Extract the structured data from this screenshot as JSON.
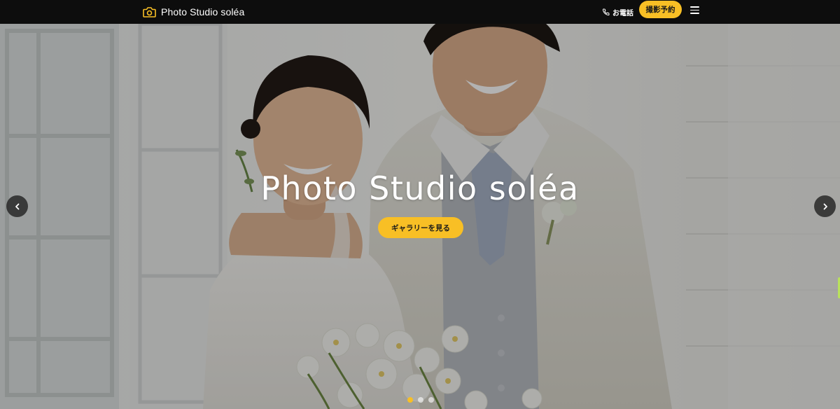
{
  "header": {
    "logo_text": "Photo Studio soléa",
    "logo_icon": "camera-icon",
    "phone_label": "お電話",
    "phone_icon": "phone-icon",
    "reserve_label": "撮影予約",
    "menu_icon": "hamburger-menu-icon"
  },
  "hero": {
    "title": "Photo Studio soléa",
    "cta_label": "ギャラリーを見る",
    "prev_icon": "chevron-left-icon",
    "next_icon": "chevron-right-icon",
    "slides": [
      {
        "active": true
      },
      {
        "active": false
      },
      {
        "active": false
      }
    ]
  },
  "colors": {
    "header_bg": "#0d0d0d",
    "accent": "#f8bf25",
    "arrow_bg": "#282828",
    "edge_tab": "#b9e15c"
  }
}
